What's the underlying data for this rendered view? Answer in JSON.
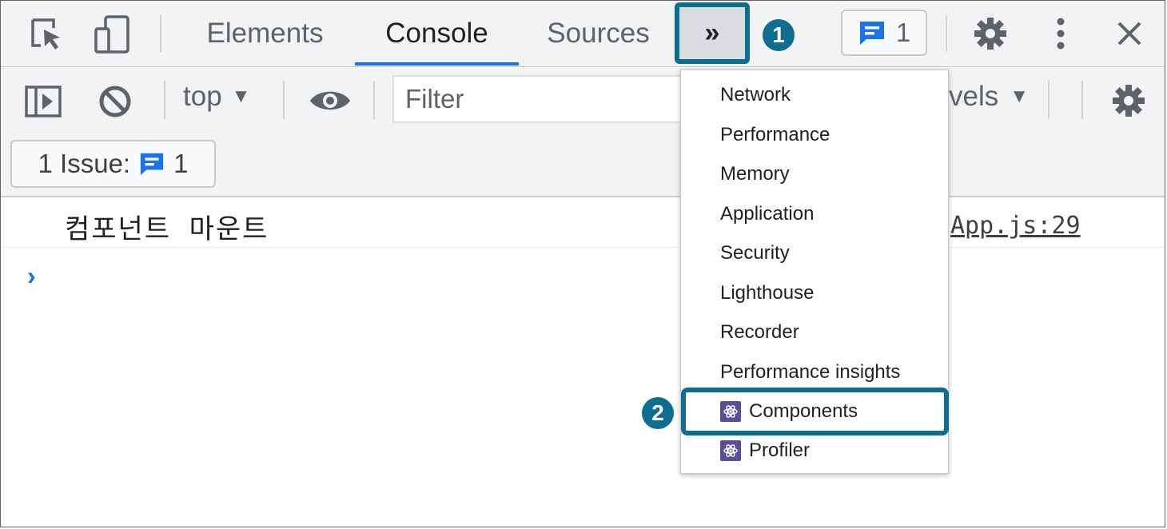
{
  "tabs": [
    {
      "label": "Elements"
    },
    {
      "label": "Console"
    },
    {
      "label": "Sources"
    }
  ],
  "more_tabs_label": "»",
  "step_markers": [
    "1",
    "2"
  ],
  "issues_counter": "1",
  "console_toolbar": {
    "context": "top",
    "filter_placeholder": "Filter",
    "levels_label": "vels"
  },
  "issues_bar": {
    "label": "1 Issue:",
    "count": "1"
  },
  "log": {
    "message": "컴포넌트 마운트",
    "source": "App.js:29"
  },
  "overflow_menu": {
    "items": [
      {
        "label": "Network"
      },
      {
        "label": "Performance"
      },
      {
        "label": "Memory"
      },
      {
        "label": "Application"
      },
      {
        "label": "Security"
      },
      {
        "label": "Lighthouse"
      },
      {
        "label": "Recorder"
      },
      {
        "label": "Performance insights"
      },
      {
        "label": "Components",
        "icon": "react-icon"
      },
      {
        "label": "Profiler",
        "icon": "react-icon"
      }
    ]
  },
  "colors": {
    "accent_blue": "#1a73e8",
    "highlight_teal": "#0e6e91",
    "react_badge": "#5b4d9a"
  }
}
